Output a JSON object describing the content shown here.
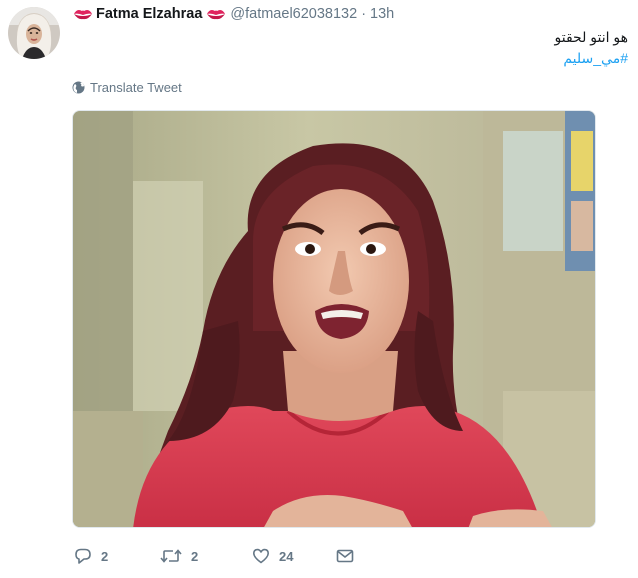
{
  "tweet": {
    "display_name": "Fatma Elzahraa",
    "handle": "@fatmael62038132",
    "separator": "·",
    "time": "13h",
    "text": "هو انتو لحقتو",
    "hashtag": "#مي_سليم",
    "translate_label": "Translate Tweet",
    "media_icon": "photo-of-woman-in-red-shirt",
    "name_emoji": "kiss-mark-icon"
  },
  "actions": {
    "reply_count": "2",
    "retweet_count": "2",
    "like_count": "24"
  },
  "colors": {
    "link": "#1da1f2",
    "secondary_text": "#657786",
    "primary_text": "#14171a",
    "kiss_red": "#e0245e"
  }
}
